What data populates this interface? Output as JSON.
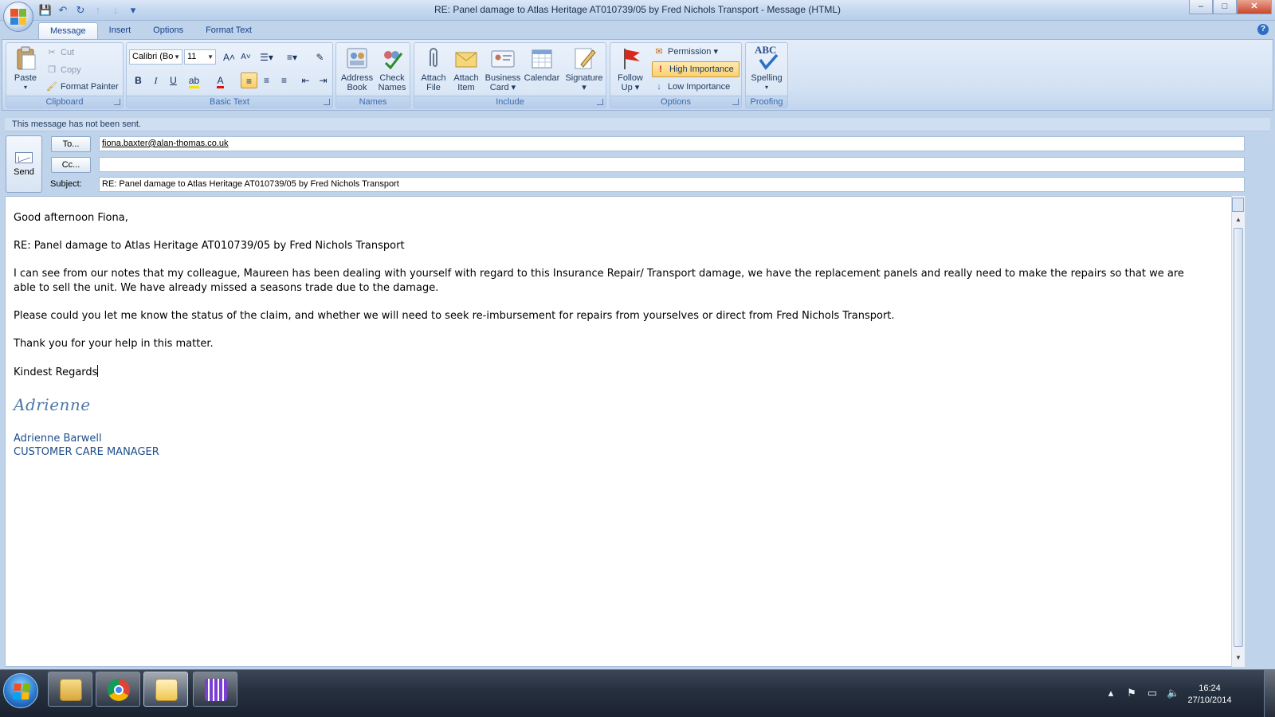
{
  "window": {
    "title": "RE: Panel damage to Atlas Heritage AT010739/05 by Fred Nichols Transport - Message (HTML)",
    "min_label": "–",
    "max_label": "□",
    "close_label": "✕"
  },
  "quick_access": [
    {
      "name": "save-icon",
      "glyph": "💾"
    },
    {
      "name": "undo-icon",
      "glyph": "↶"
    },
    {
      "name": "redo-icon",
      "glyph": "↻"
    },
    {
      "name": "previous-item-icon",
      "glyph": "↑"
    },
    {
      "name": "next-item-icon",
      "glyph": "↓"
    },
    {
      "name": "customize-qat-icon",
      "glyph": "▾"
    }
  ],
  "tabs": [
    "Message",
    "Insert",
    "Options",
    "Format Text"
  ],
  "help_label": "?",
  "ribbon": {
    "clipboard": {
      "label": "Clipboard",
      "paste": "Paste",
      "cut": "Cut",
      "copy": "Copy",
      "format_painter": "Format Painter"
    },
    "basic_text": {
      "label": "Basic Text",
      "font": "Calibri (Bo",
      "size": "11",
      "grow": "A˄",
      "shrink": "A˅",
      "bold": "B",
      "italic": "I",
      "underline": "U"
    },
    "names": {
      "label": "Names",
      "address_book_1": "Address",
      "address_book_2": "Book",
      "check_names_1": "Check",
      "check_names_2": "Names"
    },
    "include": {
      "label": "Include",
      "attach_file_1": "Attach",
      "attach_file_2": "File",
      "attach_item_1": "Attach",
      "attach_item_2": "Item",
      "business_card_1": "Business",
      "business_card_2": "Card ▾",
      "calendar": "Calendar",
      "signature_1": "Signature",
      "signature_2": "▾"
    },
    "options": {
      "label": "Options",
      "follow_up_1": "Follow",
      "follow_up_2": "Up ▾",
      "permission": "Permission ▾",
      "high_importance": "High Importance",
      "low_importance": "Low Importance"
    },
    "proofing": {
      "label": "Proofing",
      "spelling": "Spelling",
      "spelling_arrow": "▾",
      "abc": "ABC"
    }
  },
  "compose": {
    "info_bar": "This message has not been sent.",
    "send_label": "Send",
    "to_button": "To...",
    "cc_button": "Cc...",
    "subject_label": "Subject:",
    "to_value": "fiona.baxter@alan-thomas.co.uk",
    "cc_value": "",
    "subject_value": "RE: Panel damage to Atlas Heritage AT010739/05 by Fred Nichols Transport"
  },
  "body": {
    "greeting": "Good afternoon Fiona,",
    "re_line": "RE: Panel damage to Atlas Heritage AT010739/05 by Fred Nichols Transport",
    "para1": "I can see from our notes that my colleague, Maureen has been dealing with yourself with regard to this Insurance Repair/ Transport damage, we have the replacement panels and really need to make the repairs so that we are able to sell the unit.  We have already missed a seasons trade due to the damage.",
    "para2": "Please could you let me know the status of the claim, and whether we will need to seek re-imbursement for repairs from yourselves or direct from Fred Nichols Transport.",
    "para3": "Thank you for your help in this matter.",
    "closing": "Kindest Regards",
    "signature_script": "Adrienne",
    "sig_name": "Adrienne Barwell",
    "sig_title": "CUSTOMER CARE MANAGER"
  },
  "taskbar": {
    "apps": [
      "windows-explorer",
      "google-chrome",
      "outlook",
      "app-grid"
    ],
    "time": "16:24",
    "date": "27/10/2014"
  },
  "colors": {
    "ribbon_bg": "#d2e1f3",
    "accent": "#15428b",
    "signature": "#1f4e8a",
    "high_importance": "#fbd170"
  }
}
